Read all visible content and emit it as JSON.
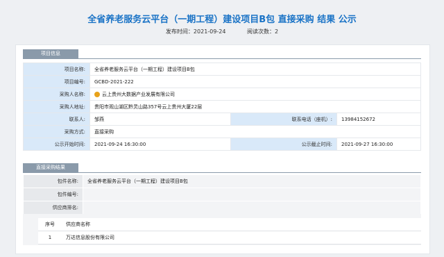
{
  "title": "全省养老服务云平台（一期工程）建设项目B包 直接采购 结果 公示",
  "meta": {
    "publish_label": "发布时间：",
    "publish_time": "2021-09-24",
    "views_label": "阅读次数：",
    "views": "2"
  },
  "project_section": {
    "title": "项目信息"
  },
  "project": {
    "name_label": "项目名称:",
    "name": "全省养老服务云平台（一期工程）建设项目B包",
    "code_label": "项目编号:",
    "code": "GCBD-2021-222",
    "buyer_label": "采购人名称:",
    "buyer": "云上贵州大数据产业发展有限公司",
    "address_label": "采购人地址:",
    "address": "贵阳市观山湖区黔灵山路357号云上贵州大厦22层",
    "contact_label": "联系人:",
    "contact": "邹燕",
    "phone_label": "联系电话（座机）:",
    "phone": "13984152672",
    "method_label": "采购方式:",
    "method": "直接采购",
    "start_label": "公示开始时间:",
    "start": "2021-09-24 16:30:00",
    "end_label": "公示截止时间:",
    "end": "2021-09-27 16:30:00"
  },
  "result_section": {
    "title": "直接采购结果"
  },
  "result": {
    "package_name_label": "包件名称:",
    "package_name": "全省养老服务云平台（一期工程）建设项目B包",
    "package_code_label": "包件编号:",
    "package_code": "",
    "supplier_rank_label": "供应商排名:",
    "headers": {
      "no": "序号",
      "supplier": "供应商名称"
    },
    "rows": [
      {
        "no": "1",
        "supplier": "万达信息股份有限公司"
      }
    ]
  }
}
